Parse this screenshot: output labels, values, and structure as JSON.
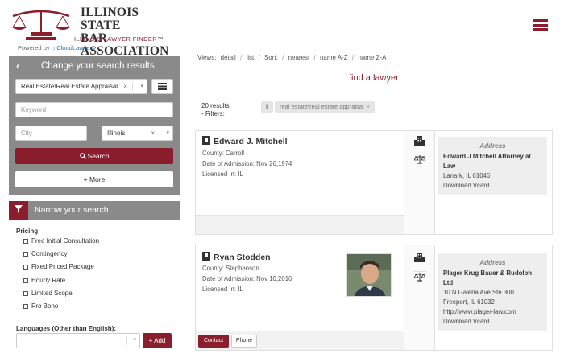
{
  "header": {
    "org_line1": "ILLINOIS STATE",
    "org_line2": "BAR ASSOCIATION",
    "org_sub": "ILLINOIS LAWYER FINDER™",
    "powered_prefix": "Powered by",
    "powered_brand": "CloudLawyers"
  },
  "search": {
    "title": "Change your search results",
    "back_glyph": "‹",
    "category_value": "Real Estate\\Real Estate Appraisal",
    "keyword_placeholder": "Keyword",
    "city_placeholder": "City",
    "state_value": "Illinois",
    "clear_glyph": "×",
    "dropdown_glyph": "▾",
    "search_label": "Search",
    "more_label": "+ More"
  },
  "narrow": {
    "title": "Narrow your search",
    "pricing_label": "Pricing:",
    "pricing_options": [
      "Free Initial Consultation",
      "Contingency",
      "Fixed Priced Package",
      "Hourly Rate",
      "Limited Scope",
      "Pro Bono"
    ],
    "languages_label": "Languages (Other than English):",
    "add_label": "+ Add"
  },
  "toolbar": {
    "views_label": "Views:",
    "detail": "detail",
    "list": "list",
    "sort_label": "Sort:",
    "nearest": "nearest",
    "name_az": "name A-Z",
    "name_za": "name Z-A",
    "separator": "/"
  },
  "find_title": "find a lawyer",
  "results": {
    "count_text": "20 results",
    "filters_label": "- Filters:",
    "tag_state": "il",
    "tag_category": "real estate\\real estate appraisal"
  },
  "lawyers": [
    {
      "name": "Edward J. Mitchell",
      "county": "County: Carroll",
      "admission": "Date of Admission: Nov 26,1974",
      "licensed": "Licensed In: IL",
      "address_title": "Address",
      "firm": "Edward J Mitchell Attorney at Law",
      "lines": [
        "Lanark, IL 61046"
      ],
      "vcard": "Download Vcard"
    },
    {
      "name": "Ryan Stodden",
      "county": "County: Stephenson",
      "admission": "Date of Admission: Nov 10,2016",
      "licensed": "Licensed In: IL",
      "address_title": "Address",
      "firm": "Plager Krug Bauer & Rudolph Ltd",
      "lines": [
        "10 N Galena Ave Ste 300",
        "Freeport, IL 61032",
        "http://www.plager-law.com"
      ],
      "vcard": "Download Vcard",
      "contact_label": "Contact",
      "phone_label": "Phone"
    }
  ],
  "colors": {
    "brand": "#8b1e2d",
    "panel_gray": "#8a8a8a"
  }
}
